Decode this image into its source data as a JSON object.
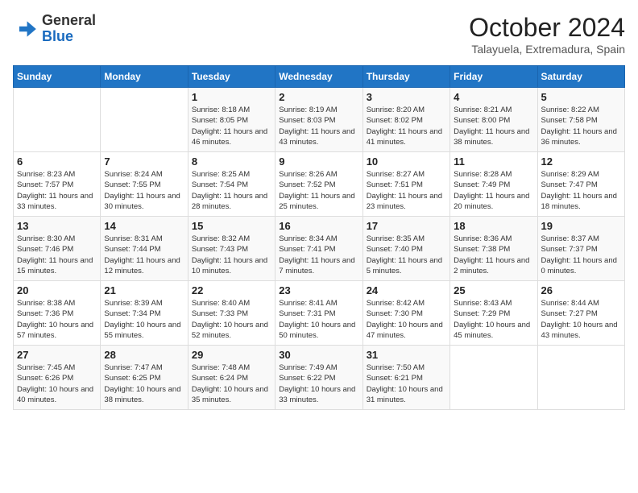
{
  "logo": {
    "general": "General",
    "blue": "Blue"
  },
  "header": {
    "month": "October 2024",
    "location": "Talayuela, Extremadura, Spain"
  },
  "weekdays": [
    "Sunday",
    "Monday",
    "Tuesday",
    "Wednesday",
    "Thursday",
    "Friday",
    "Saturday"
  ],
  "weeks": [
    [
      {
        "day": "",
        "info": ""
      },
      {
        "day": "",
        "info": ""
      },
      {
        "day": "1",
        "info": "Sunrise: 8:18 AM\nSunset: 8:05 PM\nDaylight: 11 hours and 46 minutes."
      },
      {
        "day": "2",
        "info": "Sunrise: 8:19 AM\nSunset: 8:03 PM\nDaylight: 11 hours and 43 minutes."
      },
      {
        "day": "3",
        "info": "Sunrise: 8:20 AM\nSunset: 8:02 PM\nDaylight: 11 hours and 41 minutes."
      },
      {
        "day": "4",
        "info": "Sunrise: 8:21 AM\nSunset: 8:00 PM\nDaylight: 11 hours and 38 minutes."
      },
      {
        "day": "5",
        "info": "Sunrise: 8:22 AM\nSunset: 7:58 PM\nDaylight: 11 hours and 36 minutes."
      }
    ],
    [
      {
        "day": "6",
        "info": "Sunrise: 8:23 AM\nSunset: 7:57 PM\nDaylight: 11 hours and 33 minutes."
      },
      {
        "day": "7",
        "info": "Sunrise: 8:24 AM\nSunset: 7:55 PM\nDaylight: 11 hours and 30 minutes."
      },
      {
        "day": "8",
        "info": "Sunrise: 8:25 AM\nSunset: 7:54 PM\nDaylight: 11 hours and 28 minutes."
      },
      {
        "day": "9",
        "info": "Sunrise: 8:26 AM\nSunset: 7:52 PM\nDaylight: 11 hours and 25 minutes."
      },
      {
        "day": "10",
        "info": "Sunrise: 8:27 AM\nSunset: 7:51 PM\nDaylight: 11 hours and 23 minutes."
      },
      {
        "day": "11",
        "info": "Sunrise: 8:28 AM\nSunset: 7:49 PM\nDaylight: 11 hours and 20 minutes."
      },
      {
        "day": "12",
        "info": "Sunrise: 8:29 AM\nSunset: 7:47 PM\nDaylight: 11 hours and 18 minutes."
      }
    ],
    [
      {
        "day": "13",
        "info": "Sunrise: 8:30 AM\nSunset: 7:46 PM\nDaylight: 11 hours and 15 minutes."
      },
      {
        "day": "14",
        "info": "Sunrise: 8:31 AM\nSunset: 7:44 PM\nDaylight: 11 hours and 12 minutes."
      },
      {
        "day": "15",
        "info": "Sunrise: 8:32 AM\nSunset: 7:43 PM\nDaylight: 11 hours and 10 minutes."
      },
      {
        "day": "16",
        "info": "Sunrise: 8:34 AM\nSunset: 7:41 PM\nDaylight: 11 hours and 7 minutes."
      },
      {
        "day": "17",
        "info": "Sunrise: 8:35 AM\nSunset: 7:40 PM\nDaylight: 11 hours and 5 minutes."
      },
      {
        "day": "18",
        "info": "Sunrise: 8:36 AM\nSunset: 7:38 PM\nDaylight: 11 hours and 2 minutes."
      },
      {
        "day": "19",
        "info": "Sunrise: 8:37 AM\nSunset: 7:37 PM\nDaylight: 11 hours and 0 minutes."
      }
    ],
    [
      {
        "day": "20",
        "info": "Sunrise: 8:38 AM\nSunset: 7:36 PM\nDaylight: 10 hours and 57 minutes."
      },
      {
        "day": "21",
        "info": "Sunrise: 8:39 AM\nSunset: 7:34 PM\nDaylight: 10 hours and 55 minutes."
      },
      {
        "day": "22",
        "info": "Sunrise: 8:40 AM\nSunset: 7:33 PM\nDaylight: 10 hours and 52 minutes."
      },
      {
        "day": "23",
        "info": "Sunrise: 8:41 AM\nSunset: 7:31 PM\nDaylight: 10 hours and 50 minutes."
      },
      {
        "day": "24",
        "info": "Sunrise: 8:42 AM\nSunset: 7:30 PM\nDaylight: 10 hours and 47 minutes."
      },
      {
        "day": "25",
        "info": "Sunrise: 8:43 AM\nSunset: 7:29 PM\nDaylight: 10 hours and 45 minutes."
      },
      {
        "day": "26",
        "info": "Sunrise: 8:44 AM\nSunset: 7:27 PM\nDaylight: 10 hours and 43 minutes."
      }
    ],
    [
      {
        "day": "27",
        "info": "Sunrise: 7:45 AM\nSunset: 6:26 PM\nDaylight: 10 hours and 40 minutes."
      },
      {
        "day": "28",
        "info": "Sunrise: 7:47 AM\nSunset: 6:25 PM\nDaylight: 10 hours and 38 minutes."
      },
      {
        "day": "29",
        "info": "Sunrise: 7:48 AM\nSunset: 6:24 PM\nDaylight: 10 hours and 35 minutes."
      },
      {
        "day": "30",
        "info": "Sunrise: 7:49 AM\nSunset: 6:22 PM\nDaylight: 10 hours and 33 minutes."
      },
      {
        "day": "31",
        "info": "Sunrise: 7:50 AM\nSunset: 6:21 PM\nDaylight: 10 hours and 31 minutes."
      },
      {
        "day": "",
        "info": ""
      },
      {
        "day": "",
        "info": ""
      }
    ]
  ]
}
